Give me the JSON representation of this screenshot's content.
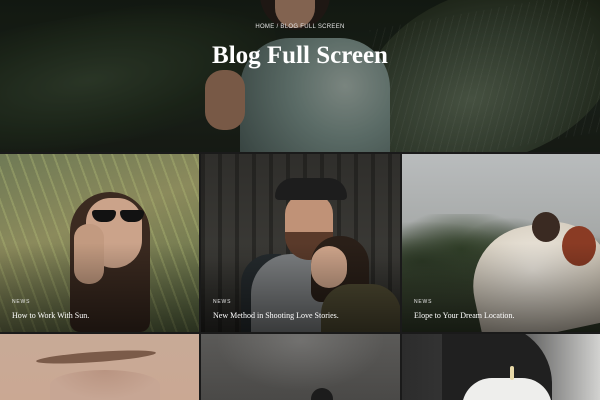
{
  "hero": {
    "breadcrumb": "HOME / BLOG FULL SCREEN",
    "title": "Blog Full Screen"
  },
  "posts": [
    {
      "category": "NEWS",
      "title": "How to Work With Sun."
    },
    {
      "category": "NEWS",
      "title": "New Method in Shooting Love Stories."
    },
    {
      "category": "NEWS",
      "title": "Elope to Your Dream Location."
    },
    {
      "category": "",
      "title": ""
    },
    {
      "category": "",
      "title": ""
    },
    {
      "category": "",
      "title": ""
    }
  ]
}
